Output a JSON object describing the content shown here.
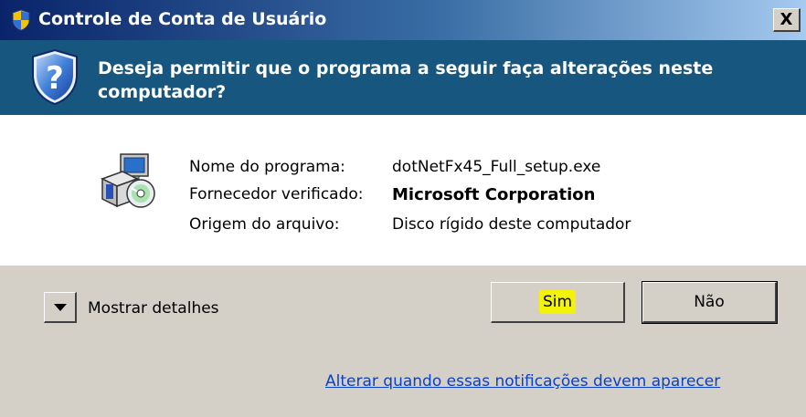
{
  "window": {
    "title": "Controle de Conta de Usuário",
    "close_label": "X"
  },
  "header": {
    "question": "Deseja permitir que o programa a seguir faça alterações neste computador?",
    "icon": "uac-shield-question-icon"
  },
  "info": {
    "icon": "setup-program-icon",
    "rows": [
      {
        "label": "Nome do programa:",
        "value": "dotNetFx45_Full_setup.exe"
      },
      {
        "label": "Fornecedor verificado:",
        "value": "Microsoft Corporation"
      },
      {
        "label": "Origem do arquivo:",
        "value": "Disco rígido deste computador"
      }
    ]
  },
  "footer": {
    "details_label": "Mostrar detalhes",
    "yes_label": "Sim",
    "no_label": "Não",
    "change_link": "Alterar quando essas notificações devem aparecer"
  },
  "colors": {
    "header_band": "#17567f",
    "dialog_bg": "#d4d0c8",
    "link": "#0b40c8",
    "highlight": "#f2f20a"
  }
}
